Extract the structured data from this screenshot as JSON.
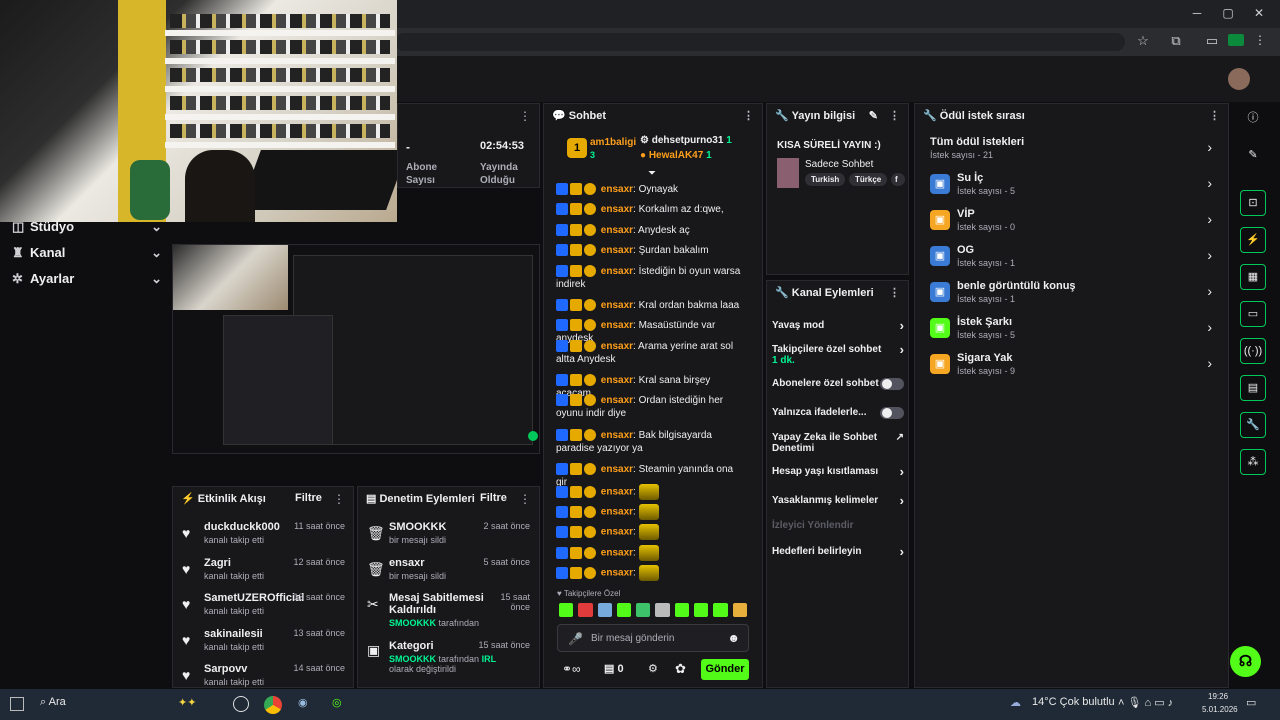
{
  "window": {
    "minimize": "─",
    "maximize": "▢",
    "close": "✕"
  },
  "browser": {
    "star": "☆",
    "ext": "⧉",
    "cast": "▭"
  },
  "nav": {
    "items": [
      {
        "label": "Stüdyo",
        "icon": "◫"
      },
      {
        "label": "Kanal",
        "icon": "♜"
      },
      {
        "label": "Ayarlar",
        "icon": "✲"
      }
    ]
  },
  "stats": {
    "dash": "-",
    "abone_label": "Abone Sayısı",
    "uptime": "02:54:53",
    "uptime_label": "Yayında Olduğu"
  },
  "events": {
    "title": "Etkinlik Akışı",
    "filter": "Filtre",
    "items": [
      {
        "name": "duckduckk000",
        "sub": "kanalı takip etti",
        "time": "11 saat önce"
      },
      {
        "name": "Zagri",
        "sub": "kanalı takip etti",
        "time": "12 saat önce"
      },
      {
        "name": "SametUZEROfficial",
        "sub": "kanalı takip etti",
        "time": "13 saat önce"
      },
      {
        "name": "sakinailesii",
        "sub": "kanalı takip etti",
        "time": "13 saat önce"
      },
      {
        "name": "Sarpovv",
        "sub": "kanalı takip etti",
        "time": "14 saat önce"
      }
    ]
  },
  "moderation": {
    "title": "Denetim Eylemleri",
    "filter": "Filtre",
    "items": [
      {
        "name": "SMOOKKK",
        "sub": "bir mesajı sildi",
        "time": "2 saat önce"
      },
      {
        "name": "ensaxr",
        "sub": "bir mesajı sildi",
        "time": "5 saat önce"
      },
      {
        "name": "Mesaj Sabitlemesi Kaldırıldı",
        "actor": "SMOOKKK",
        "sub": "tarafından",
        "time": "15 saat önce"
      },
      {
        "name": "Kategori",
        "actor": "SMOOKKK",
        "sub": "tarafından",
        "cat": "IRL",
        "sub2": "olarak değiştirildi",
        "time": "15 saat önce"
      }
    ]
  },
  "chat": {
    "title": "Sohbet",
    "top1": "am1baligi",
    "top1_count": "3",
    "top2": "dehsetpurno31",
    "top2_count": "1",
    "top3": "HewalAK47",
    "top3_count": "1",
    "messages": [
      {
        "user": "ensaxr",
        "text": ": Oynayak"
      },
      {
        "user": "ensaxr",
        "text": ": Korkalım az d:qwe,"
      },
      {
        "user": "ensaxr",
        "text": ": Anydesk aç"
      },
      {
        "user": "ensaxr",
        "text": ": Şurdan bakalım"
      },
      {
        "user": "ensaxr",
        "text": ": İstediğin bi oyun warsa indirek"
      },
      {
        "user": "ensaxr",
        "text": ": Kral ordan bakma laaa"
      },
      {
        "user": "ensaxr",
        "text": ": Masaüstünde var anydesk"
      },
      {
        "user": "ensaxr",
        "text": ": Arama yerine arat sol altta Anydesk"
      },
      {
        "user": "ensaxr",
        "text": ": Kral sana birşey açacam"
      },
      {
        "user": "ensaxr",
        "text": ": Ordan istediğin her oyunu indir diye"
      },
      {
        "user": "ensaxr",
        "text": ": Bak bilgisayarda paradise yazıyor ya"
      },
      {
        "user": "ensaxr",
        "text": ": Steamin yanında ona gir"
      },
      {
        "user": "ensaxr",
        "text": ":"
      },
      {
        "user": "ensaxr",
        "text": ":"
      },
      {
        "user": "ensaxr",
        "text": ":"
      },
      {
        "user": "ensaxr",
        "text": ":"
      },
      {
        "user": "ensaxr",
        "text": ":"
      }
    ],
    "followers_only": "Takipçilere Özel",
    "placeholder": "Bir mesaj gönderin",
    "points": "0",
    "send": "Gönder"
  },
  "streaminfo": {
    "title": "Yayın bilgisi",
    "stream_title": "KISA SÜRELİ YAYIN :)",
    "category": "Sadece Sohbet",
    "tags": [
      "Turkish",
      "Türkçe",
      "f"
    ]
  },
  "actions": {
    "title": "Kanal Eylemleri",
    "items": [
      {
        "label": "Yavaş mod"
      },
      {
        "label": "Takipçilere özel sohbet",
        "sub": "1 dk."
      },
      {
        "label": "Abonelere özel sohbet"
      },
      {
        "label": "Yalnızca ifadelerle..."
      },
      {
        "label": "Yapay Zeka ile Sohbet Denetimi"
      },
      {
        "label": "Hesap yaşı kısıtlaması"
      },
      {
        "label": "Yasaklanmış kelimeler"
      },
      {
        "label": "İzleyici Yönlendir"
      },
      {
        "label": "Hedefleri belirleyin"
      }
    ]
  },
  "rewards": {
    "title": "Ödül istek sırası",
    "all": {
      "label": "Tüm ödül istekleri",
      "sub": "İstek sayısı - 21"
    },
    "items": [
      {
        "label": "Su İç",
        "sub": "İstek sayısı - 5",
        "color": "#3a7bd5"
      },
      {
        "label": "VİP",
        "sub": "İstek sayısı - 0",
        "color": "#f5a623"
      },
      {
        "label": "OG",
        "sub": "İstek sayısı - 1",
        "color": "#3a7bd5"
      },
      {
        "label": "benle görüntülü konuş",
        "sub": "İstek sayısı - 1",
        "color": "#3a7bd5"
      },
      {
        "label": "İstek Şarkı",
        "sub": "İstek sayısı - 5",
        "color": "#53fc18"
      },
      {
        "label": "Sigara Yak",
        "sub": "İstek sayısı - 9",
        "color": "#f5a623"
      }
    ]
  },
  "taskbar": {
    "search": "Ara",
    "weather": "14°C  Çok bulutlu",
    "time": "19:26",
    "date": "5.01.2026"
  }
}
